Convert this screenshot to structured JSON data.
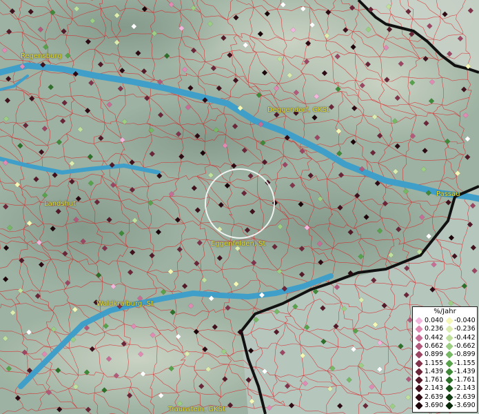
{
  "map": {
    "cities": [
      {
        "name": "Regensburg"
      },
      {
        "name": "Deggendorf, GKSt"
      },
      {
        "name": "Passau"
      },
      {
        "name": "Landshut"
      },
      {
        "name": "Eggenfelden, St"
      },
      {
        "name": "Waldkraiburg, St"
      },
      {
        "name": "Traunstein, GKSt"
      }
    ]
  },
  "legend": {
    "title": "%/Jahr",
    "positive": [
      {
        "value": "0.040",
        "color": "#f2b6dd"
      },
      {
        "value": "0.236",
        "color": "#e08ab4"
      },
      {
        "value": "0.442",
        "color": "#c86d95"
      },
      {
        "value": "0.662",
        "color": "#b35a7c"
      },
      {
        "value": "0.899",
        "color": "#9c4663"
      },
      {
        "value": "1.155",
        "color": "#83344d"
      },
      {
        "value": "1.439",
        "color": "#6b2639"
      },
      {
        "value": "1.761",
        "color": "#551a2a"
      },
      {
        "value": "2.143",
        "color": "#41111e"
      },
      {
        "value": "2.639",
        "color": "#2e0b14"
      },
      {
        "value": "3.690",
        "color": "#1d060b"
      }
    ],
    "negative": [
      {
        "value": "-0.040",
        "color": "#f4f7b6"
      },
      {
        "value": "-0.236",
        "color": "#dcecae"
      },
      {
        "value": "-0.442",
        "color": "#c0e09e"
      },
      {
        "value": "-0.662",
        "color": "#9ccf84"
      },
      {
        "value": "-0.899",
        "color": "#76b864"
      },
      {
        "value": "-1.155",
        "color": "#57a24b"
      },
      {
        "value": "-1.439",
        "color": "#3e8a38"
      },
      {
        "value": "-1.761",
        "color": "#2c7029"
      },
      {
        "value": "-2.143",
        "color": "#1d561c"
      },
      {
        "value": "-2.639",
        "color": "#123d12"
      },
      {
        "value": "-3.690",
        "color": "#0a280a"
      }
    ]
  },
  "colors": {
    "river": "#3f9fc9",
    "borders": "#e0151b",
    "state_border": "#111111",
    "label": "#e8e02a"
  }
}
